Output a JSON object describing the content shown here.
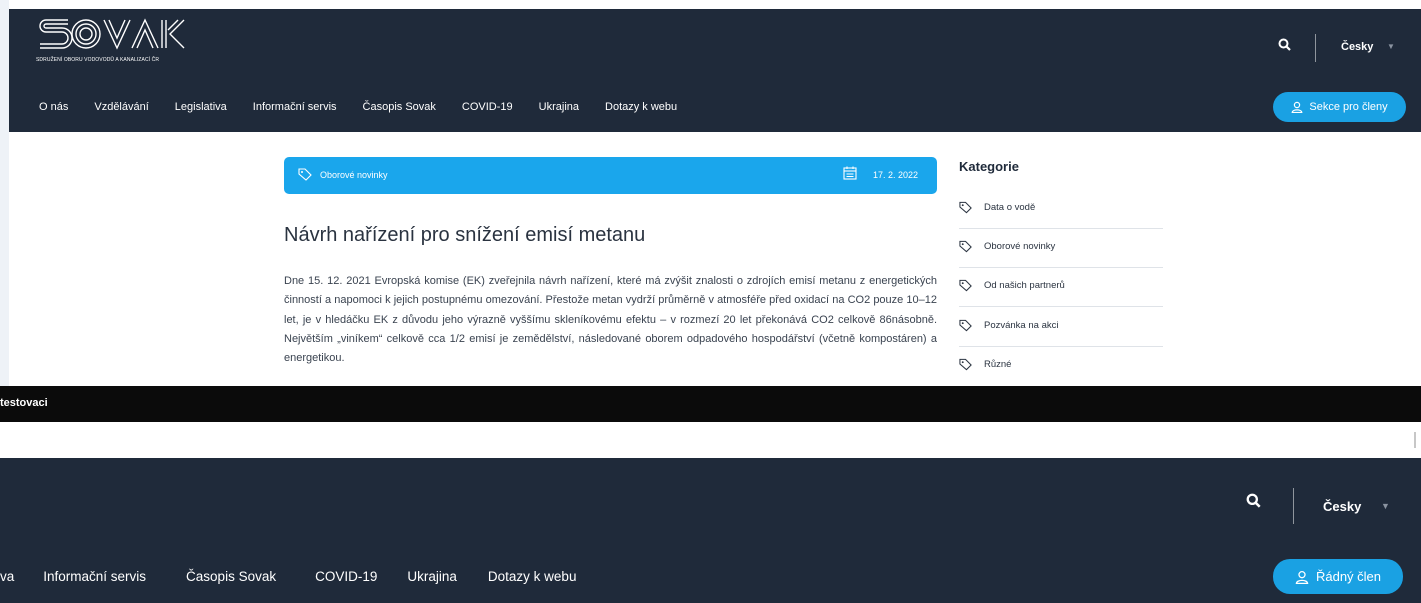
{
  "top_site": {
    "logo_text": "SOVAK",
    "logo_subtitle": "SDRUŽENÍ OBORU VODOVODŮ A KANALIZACÍ ČR",
    "nav": [
      "O nás",
      "Vzdělávání",
      "Legislativa",
      "Informační servis",
      "Časopis Sovak",
      "COVID-19",
      "Ukrajina",
      "Dotazy k webu"
    ],
    "language": "Česky",
    "member_button": "Sekce pro členy"
  },
  "article": {
    "category": "Oborové novinky",
    "date": "17. 2. 2022",
    "title": "Návrh nařízení pro snížení emisí metanu",
    "body": "Dne 15. 12. 2021 Evropská komise (EK) zveřejnila návrh nařízení, které má zvýšit znalosti o zdrojích emisí metanu z energetických činností a napomoci k jejich postupnému omezování. Přestože metan vydrží průměrně v atmosféře před oxidací na CO2 pouze 10–12 let, je v hledáčku EK z důvodu jeho výrazně vyššímu skleníkovému efektu – v rozmezí 20 let překonává CO2 celkově 86násobně. Největším „viníkem“ celkově cca 1/2 emisí je zemědělství, následované oborem odpadového hospodářství (včetně kompostáren) a energetikou."
  },
  "sidebar": {
    "title": "Kategorie",
    "items": [
      "Data o vodě",
      "Oborové novinky",
      "Od našich partnerů",
      "Pozvánka na akci",
      "Různé"
    ]
  },
  "dark_bar_text": "testovaci",
  "bottom_site": {
    "nav": [
      "va",
      "Informační servis",
      "Časopis Sovak",
      "COVID-19",
      "Ukrajina",
      "Dotazy k webu"
    ],
    "language": "Česky",
    "member_button": "Řádný člen"
  },
  "colors": {
    "header_bg": "#1f2a3a",
    "accent": "#1aa1e3",
    "category_bar": "#1aa6ec"
  }
}
